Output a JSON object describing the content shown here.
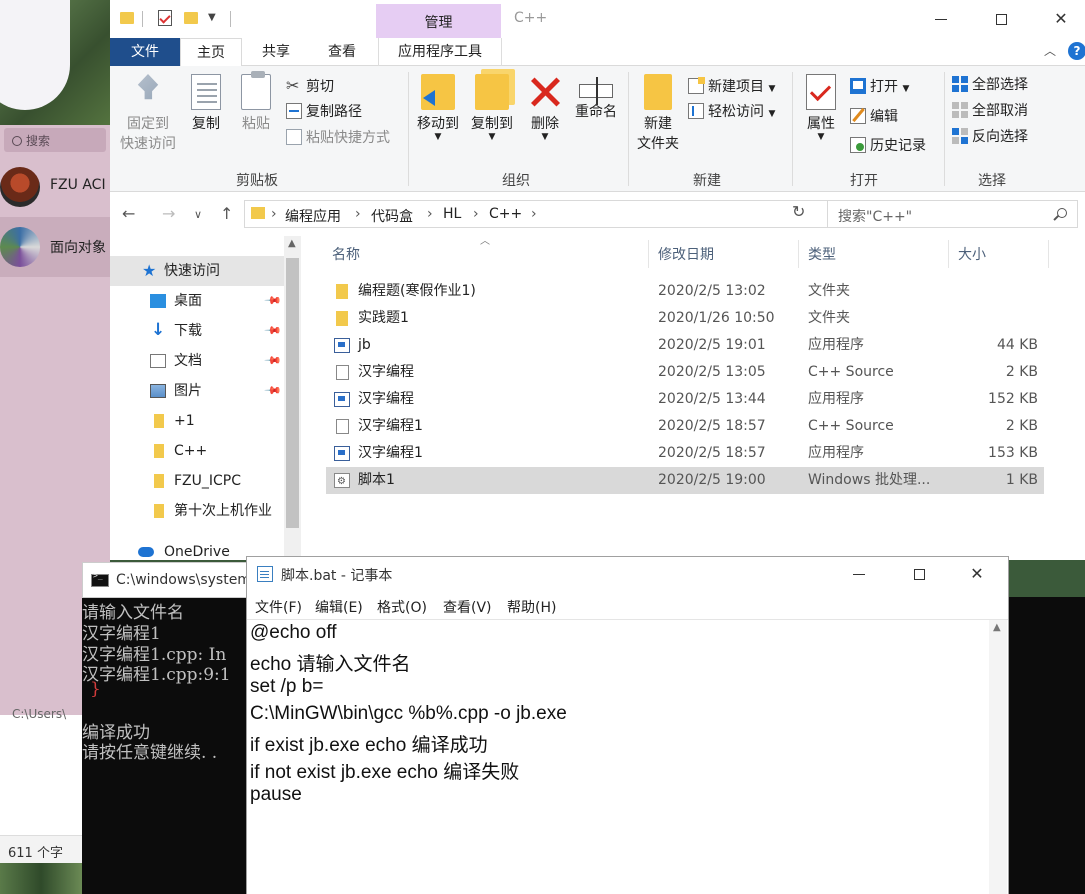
{
  "background": {
    "chat_search": "搜索",
    "contact_1": "FZU ACI",
    "contact_2": "面向对象",
    "editor_path": "C:\\Users\\",
    "status_count": "611 个字"
  },
  "explorer": {
    "manage_tab": "管理",
    "title": "C++",
    "tabs": {
      "file": "文件",
      "home": "主页",
      "share": "共享",
      "view": "查看",
      "app_tools": "应用程序工具"
    },
    "clipboard": {
      "pin": "固定到\n快速访问",
      "copy": "复制",
      "paste": "粘贴",
      "cut": "剪切",
      "copy_path": "复制路径",
      "paste_shortcut": "粘贴快捷方式",
      "label": "剪贴板"
    },
    "organize": {
      "move_to": "移动到",
      "copy_to": "复制到",
      "delete": "删除",
      "rename": "重命名",
      "label": "组织"
    },
    "new": {
      "new_folder": "新建\n文件夹",
      "new_item": "新建项目",
      "easy_access": "轻松访问",
      "label": "新建"
    },
    "open": {
      "properties": "属性",
      "open": "打开",
      "edit": "编辑",
      "history": "历史记录",
      "label": "打开"
    },
    "select": {
      "select_all": "全部选择",
      "select_none": "全部取消",
      "invert": "反向选择",
      "label": "选择"
    },
    "address": {
      "crumbs": [
        "编程应用",
        "代码盒",
        "HL",
        "C++"
      ],
      "search_placeholder": "搜索\"C++\""
    },
    "nav": {
      "quick_access": "快速访问",
      "items": [
        "桌面",
        "下载",
        "文档",
        "图片",
        "+1",
        "C++",
        "FZU_ICPC",
        "第十次上机作业"
      ],
      "onedrive": "OneDrive"
    },
    "columns": {
      "name": "名称",
      "date": "修改日期",
      "type": "类型",
      "size": "大小"
    },
    "files": [
      {
        "name": "编程题(寒假作业1)",
        "date": "2020/2/5 13:02",
        "type": "文件夹",
        "size": "",
        "kind": "folder"
      },
      {
        "name": "实践题1",
        "date": "2020/1/26 10:50",
        "type": "文件夹",
        "size": "",
        "kind": "folder"
      },
      {
        "name": "jb",
        "date": "2020/2/5 19:01",
        "type": "应用程序",
        "size": "44 KB",
        "kind": "exe"
      },
      {
        "name": "汉字编程",
        "date": "2020/2/5 13:05",
        "type": "C++ Source",
        "size": "2 KB",
        "kind": "cpp"
      },
      {
        "name": "汉字编程",
        "date": "2020/2/5 13:44",
        "type": "应用程序",
        "size": "152 KB",
        "kind": "exe"
      },
      {
        "name": "汉字编程1",
        "date": "2020/2/5 18:57",
        "type": "C++ Source",
        "size": "2 KB",
        "kind": "cpp"
      },
      {
        "name": "汉字编程1",
        "date": "2020/2/5 18:57",
        "type": "应用程序",
        "size": "153 KB",
        "kind": "exe"
      },
      {
        "name": "脚本1",
        "date": "2020/2/5 19:00",
        "type": "Windows 批处理...",
        "size": "1 KB",
        "kind": "bat",
        "selected": true
      }
    ]
  },
  "cmd": {
    "title": "C:\\windows\\system",
    "lines": [
      "请输入文件名",
      "汉字编程1",
      "汉字编程1.cpp: In",
      "汉字编程1.cpp:9:1",
      "}",
      "编译成功",
      "请按任意键继续. ."
    ]
  },
  "notepad": {
    "title": "脚本.bat - 记事本",
    "menus": [
      "文件(F)",
      "编辑(E)",
      "格式(O)",
      "查看(V)",
      "帮助(H)"
    ],
    "lines": [
      "@echo off",
      "echo 请输入文件名",
      "set /p b=",
      "C:\\MinGW\\bin\\gcc %b%.cpp -o jb.exe",
      "if exist jb.exe echo 编译成功",
      "if not exist jb.exe echo 编译失败",
      "pause"
    ]
  }
}
